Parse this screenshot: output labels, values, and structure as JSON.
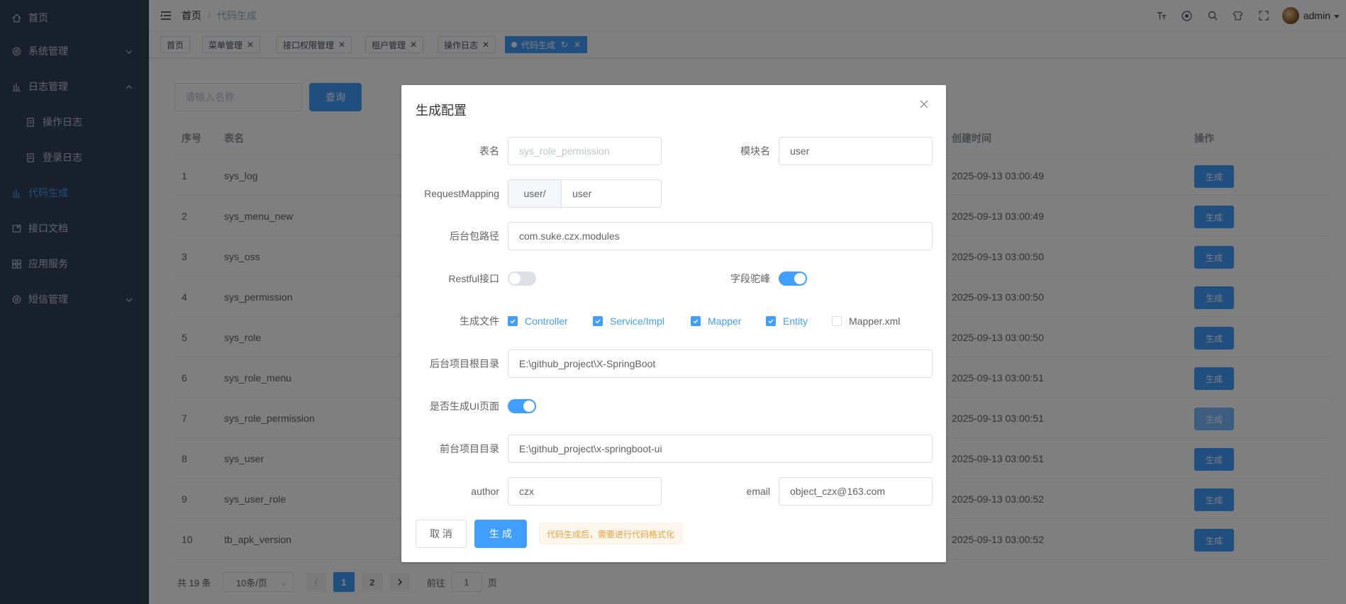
{
  "sidebar": {
    "items": [
      {
        "label": "首页",
        "icon": "home-icon"
      },
      {
        "label": "系统管理",
        "icon": "gear-icon"
      },
      {
        "label": "日志管理",
        "icon": "chart-icon"
      },
      {
        "label": "操作日志",
        "icon": "doc-icon"
      },
      {
        "label": "登录日志",
        "icon": "doc-icon"
      },
      {
        "label": "代码生成",
        "icon": "code-icon"
      },
      {
        "label": "接口文档",
        "icon": "link-icon"
      },
      {
        "label": "应用服务",
        "icon": "grid-icon"
      },
      {
        "label": "短信管理",
        "icon": "gear-icon"
      }
    ]
  },
  "header": {
    "breadcrumb_home": "首页",
    "breadcrumb_sep": "/",
    "breadcrumb_current": "代码生成",
    "icons": [
      "font-size-icon",
      "github-icon",
      "search-icon",
      "theme-icon",
      "fullscreen-icon"
    ],
    "username": "admin"
  },
  "tags": [
    {
      "label": "首页",
      "closable": false,
      "active": false
    },
    {
      "label": "菜单管理",
      "closable": true,
      "active": false
    },
    {
      "label": "接口权限管理",
      "closable": true,
      "active": false
    },
    {
      "label": "租户管理",
      "closable": true,
      "active": false
    },
    {
      "label": "操作日志",
      "closable": true,
      "active": false
    },
    {
      "label": "代码生成",
      "closable": true,
      "active": true
    }
  ],
  "search": {
    "placeholder": "请输入名称",
    "button": "查询"
  },
  "table": {
    "headers": {
      "index": "序号",
      "name": "表名",
      "created": "创建时间",
      "action": "操作"
    },
    "rows": [
      {
        "index": "1",
        "name": "sys_log",
        "created": "2025-09-13 03:00:49",
        "action": "生成"
      },
      {
        "index": "2",
        "name": "sys_menu_new",
        "created": "2025-09-13 03:00:49",
        "action": "生成"
      },
      {
        "index": "3",
        "name": "sys_oss",
        "created": "2025-09-13 03:00:50",
        "action": "生成"
      },
      {
        "index": "4",
        "name": "sys_permission",
        "created": "2025-09-13 03:00:50",
        "action": "生成"
      },
      {
        "index": "5",
        "name": "sys_role",
        "created": "2025-09-13 03:00:50",
        "action": "生成"
      },
      {
        "index": "6",
        "name": "sys_role_menu",
        "created": "2025-09-13 03:00:51",
        "action": "生成"
      },
      {
        "index": "7",
        "name": "sys_role_permission",
        "created": "2025-09-13 03:00:51",
        "action": "生成"
      },
      {
        "index": "8",
        "name": "sys_user",
        "created": "2025-09-13 03:00:51",
        "action": "生成"
      },
      {
        "index": "9",
        "name": "sys_user_role",
        "created": "2025-09-13 03:00:52",
        "action": "生成"
      },
      {
        "index": "10",
        "name": "tb_apk_version",
        "created": "2025-09-13 03:00:52",
        "action": "生成"
      }
    ]
  },
  "pagination": {
    "total": "共 19 条",
    "page_size": "10条/页",
    "pages": [
      "1",
      "2"
    ],
    "current_page": "1",
    "goto_prefix": "前往",
    "goto_value": "1",
    "goto_suffix": "页"
  },
  "modal": {
    "title": "生成配置",
    "table_name_label": "表名",
    "table_name_value": "sys_role_permission",
    "module_label": "模块名",
    "module_value": "user",
    "request_mapping_label": "RequestMapping",
    "request_mapping_prefix": "user/",
    "request_mapping_value": "user",
    "package_label": "后台包路径",
    "package_value": "com.suke.czx.modules",
    "restful_label": "Restful接口",
    "restful_on": false,
    "camel_label": "字段驼峰",
    "camel_on": true,
    "files_label": "生成文件",
    "files": [
      {
        "label": "Controller",
        "checked": true
      },
      {
        "label": "Service/Impl",
        "checked": true
      },
      {
        "label": "Mapper",
        "checked": true
      },
      {
        "label": "Entity",
        "checked": true
      },
      {
        "label": "Mapper.xml",
        "checked": false
      }
    ],
    "backend_root_label": "后台项目根目录",
    "backend_root_value": "E:\\github_project\\X-SpringBoot",
    "gen_ui_label": "是否生成UI页面",
    "gen_ui_on": true,
    "frontend_root_label": "前台项目目录",
    "frontend_root_value": "E:\\github_project\\x-springboot-ui",
    "author_label": "author",
    "author_value": "czx",
    "email_label": "email",
    "email_value": "object_czx@163.com",
    "cancel": "取 消",
    "generate": "生 成",
    "tip": "代码生成后，需要进行代码格式化"
  },
  "colors": {
    "primary": "#409eff",
    "sidebar_bg": "#304156",
    "warning": "#e6a23c"
  }
}
